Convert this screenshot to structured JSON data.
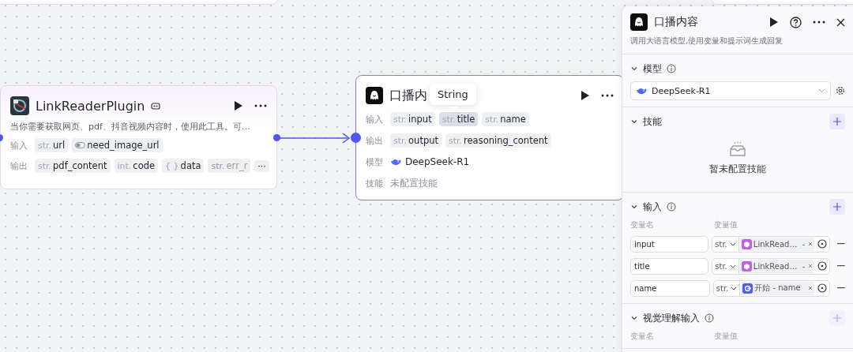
{
  "canvas": {
    "nodes": [
      {
        "kind": "plugin",
        "title": "LinkReaderPlugin",
        "description": "当你需要获取网页、pdf、抖音视频内容时，使用此工具。可…",
        "rows": [
          {
            "label": "输入",
            "params": [
              {
                "kind": "typed",
                "type": "str.",
                "name": "url",
                "highlighted": false,
                "faded": false
              },
              {
                "kind": "toggle",
                "name": "need_image_url",
                "highlighted": false,
                "faded": false
              }
            ]
          },
          {
            "label": "输出",
            "params": [
              {
                "kind": "typed",
                "type": "str.",
                "name": "pdf_content",
                "highlighted": false,
                "faded": false
              },
              {
                "kind": "typed",
                "type": "int.",
                "name": "code",
                "highlighted": false,
                "faded": false
              },
              {
                "kind": "typed",
                "type": "{ }",
                "name": "data",
                "highlighted": false,
                "faded": false
              },
              {
                "kind": "typed",
                "type": "str.",
                "name": "err_r",
                "highlighted": false,
                "faded": true
              }
            ],
            "more": "···"
          }
        ]
      },
      {
        "kind": "llm",
        "title": "口播内",
        "tooltip": "String",
        "rows": [
          {
            "label": "输入",
            "params": [
              {
                "kind": "typed",
                "type": "str.",
                "name": "input",
                "highlighted": false,
                "faded": false
              },
              {
                "kind": "typed",
                "type": "str.",
                "name": "title",
                "highlighted": true,
                "faded": false
              },
              {
                "kind": "typed",
                "type": "str.",
                "name": "name",
                "highlighted": false,
                "faded": false
              }
            ]
          },
          {
            "label": "输出",
            "params": [
              {
                "kind": "typed",
                "type": "str.",
                "name": "output",
                "highlighted": false,
                "faded": false
              },
              {
                "kind": "typed",
                "type": "str.",
                "name": "reasoning_content",
                "highlighted": false,
                "faded": false
              }
            ]
          }
        ],
        "info_rows": [
          {
            "label": "模型",
            "value": "DeepSeek-R1",
            "kind": "model"
          },
          {
            "label": "技能",
            "value": "未配置技能",
            "kind": "muted"
          }
        ]
      }
    ]
  },
  "panel": {
    "title": "口播内容",
    "description": "调用大语言模型,使用变量和提示词生成回复",
    "sections": [
      {
        "kind": "model",
        "title": "模型",
        "info": true,
        "expanded": true,
        "model": "DeepSeek-R1"
      },
      {
        "kind": "empty",
        "title": "技能",
        "info": false,
        "expanded": true,
        "add": {
          "disabled": false
        },
        "empty_text": "暂未配置技能"
      },
      {
        "kind": "variables",
        "title": "输入",
        "info": true,
        "expanded": true,
        "add": {
          "disabled": false
        },
        "columns": [
          "变量名",
          "变量值"
        ],
        "rows": [
          {
            "name": "input",
            "type": "str.",
            "kind": "plugin",
            "ref": "LinkRead…  -"
          },
          {
            "name": "title",
            "type": "str.",
            "kind": "plugin",
            "ref": "LinkRead…  -"
          },
          {
            "name": "name",
            "type": "str.",
            "kind": "start",
            "ref": "开始 - name"
          }
        ]
      },
      {
        "kind": "variables",
        "title": "视觉理解输入",
        "info": true,
        "expanded": true,
        "add": {
          "disabled": true
        },
        "columns": [
          "变量名",
          "变量值"
        ]
      }
    ]
  }
}
